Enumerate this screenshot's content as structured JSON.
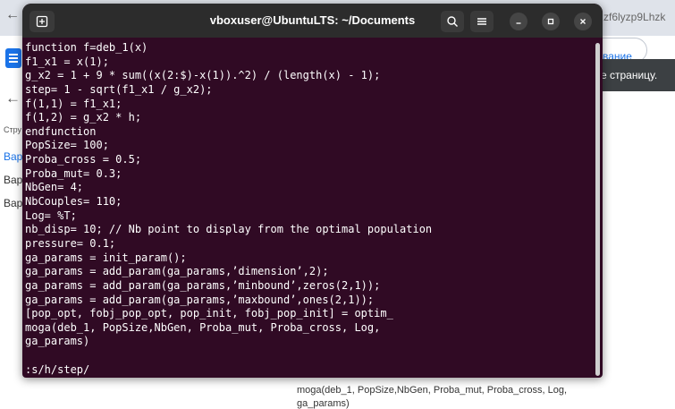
{
  "background": {
    "url_fragment": "zf6lyzp9Lhzk",
    "right_link": "вание",
    "tooltip": "е страницу.",
    "left_texts": [
      "Стру",
      "Вар",
      "Вар",
      "Вар"
    ],
    "bottom_lines": [
      "moga(deb_1, PopSize,NbGen, Proba_mut, Proba_cross, Log,",
      "ga_params)"
    ]
  },
  "terminal": {
    "title": "vboxuser@UbuntuLTS: ~/Documents",
    "lines": [
      "function f=deb_1(x)",
      "f1_x1 = x(1);",
      "g_x2 = 1 + 9 * sum((x(2:$)-x(1)).^2) / (length(x) - 1);",
      "step= 1 - sqrt(f1_x1 / g_x2);",
      "f(1,1) = f1_x1;",
      "f(1,2) = g_x2 * h;",
      "endfunction",
      "PopSize= 100;",
      "Proba_cross = 0.5;",
      "Proba_mut= 0.3;",
      "NbGen= 4;",
      "NbCouples= 110;",
      "Log= %T;",
      "nb_disp= 10; // Nb point to display from the optimal population",
      "pressure= 0.1;",
      "ga_params = init_param();",
      "ga_params = add_param(ga_params,’dimension’,2);",
      "ga_params = add_param(ga_params,’minbound’,zeros(2,1));",
      "ga_params = add_param(ga_params,’maxbound’,ones(2,1));",
      "[pop_opt, fobj_pop_opt, pop_init, fobj_pop_init] = optim_",
      "moga(deb_1, PopSize,NbGen, Proba_mut, Proba_cross, Log,",
      "ga_params)",
      "",
      ":s/h/step/"
    ]
  },
  "colors": {
    "terminal_bg": "#300a24",
    "titlebar_bg": "#2c2c2c",
    "text": "#ffffff"
  },
  "icons": {
    "new_tab": "new-tab-icon",
    "search": "search-icon",
    "menu": "hamburger-menu-icon",
    "minimize": "minimize-icon",
    "maximize": "maximize-icon",
    "close": "close-icon"
  }
}
